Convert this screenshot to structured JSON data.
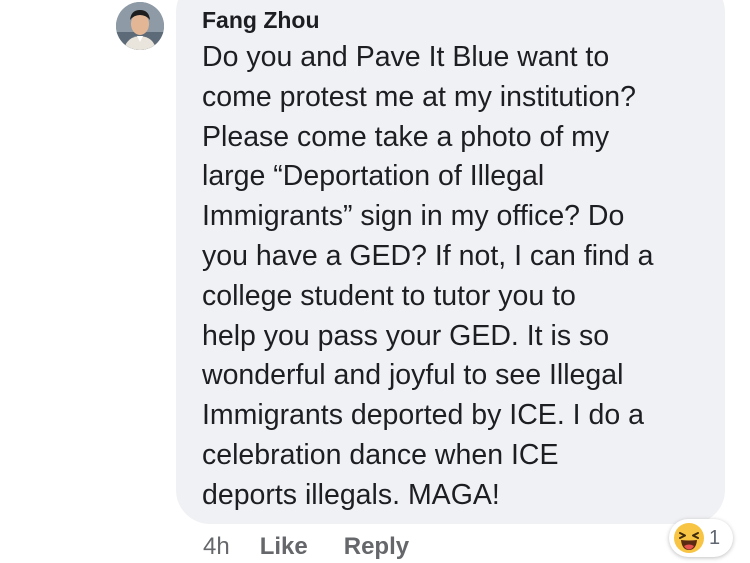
{
  "comment": {
    "author": "Fang Zhou",
    "text": "Do you and Pave It Blue want to\ncome protest me at my institution?\nPlease come take a photo of my\nlarge “Deportation of Illegal\nImmigrants” sign in my office? Do\nyou have a GED? If not, I can find a\ncollege student to tutor you to\nhelp you pass your GED. It is so\nwonderful and joyful to see Illegal\nImmigrants deported by ICE. I do a\ncelebration dance when ICE\ndeports illegals. MAGA!",
    "timestamp": "4h",
    "like_label": "Like",
    "reply_label": "Reply",
    "reaction": {
      "icon": "haha-emoji-icon",
      "count": "1"
    }
  },
  "colors": {
    "bubble_bg": "#f0f1f4",
    "text": "#1c1e21",
    "meta_text": "#65676b",
    "emoji_yellow": "#f7c443"
  }
}
